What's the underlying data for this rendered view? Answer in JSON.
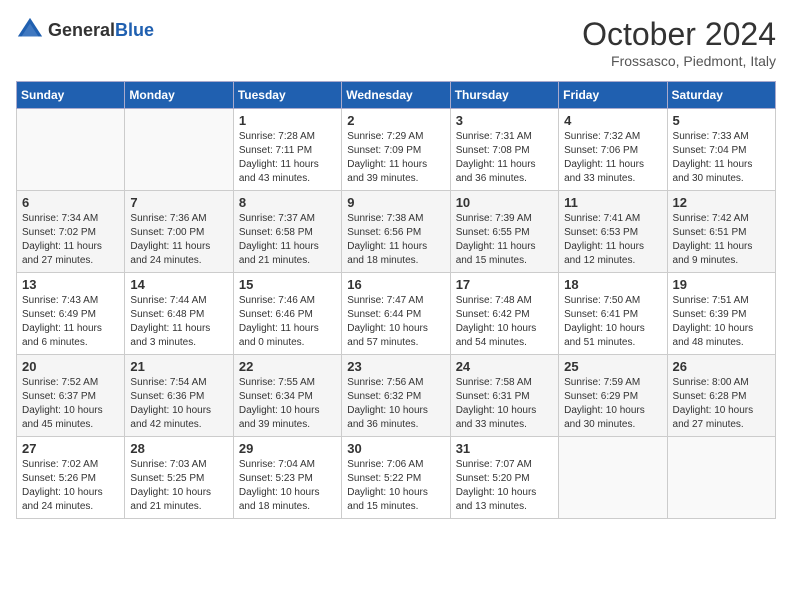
{
  "header": {
    "logo_general": "General",
    "logo_blue": "Blue",
    "month": "October 2024",
    "location": "Frossasco, Piedmont, Italy"
  },
  "weekdays": [
    "Sunday",
    "Monday",
    "Tuesday",
    "Wednesday",
    "Thursday",
    "Friday",
    "Saturday"
  ],
  "weeks": [
    [
      {
        "day": "",
        "info": ""
      },
      {
        "day": "",
        "info": ""
      },
      {
        "day": "1",
        "info": "Sunrise: 7:28 AM\nSunset: 7:11 PM\nDaylight: 11 hours and 43 minutes."
      },
      {
        "day": "2",
        "info": "Sunrise: 7:29 AM\nSunset: 7:09 PM\nDaylight: 11 hours and 39 minutes."
      },
      {
        "day": "3",
        "info": "Sunrise: 7:31 AM\nSunset: 7:08 PM\nDaylight: 11 hours and 36 minutes."
      },
      {
        "day": "4",
        "info": "Sunrise: 7:32 AM\nSunset: 7:06 PM\nDaylight: 11 hours and 33 minutes."
      },
      {
        "day": "5",
        "info": "Sunrise: 7:33 AM\nSunset: 7:04 PM\nDaylight: 11 hours and 30 minutes."
      }
    ],
    [
      {
        "day": "6",
        "info": "Sunrise: 7:34 AM\nSunset: 7:02 PM\nDaylight: 11 hours and 27 minutes."
      },
      {
        "day": "7",
        "info": "Sunrise: 7:36 AM\nSunset: 7:00 PM\nDaylight: 11 hours and 24 minutes."
      },
      {
        "day": "8",
        "info": "Sunrise: 7:37 AM\nSunset: 6:58 PM\nDaylight: 11 hours and 21 minutes."
      },
      {
        "day": "9",
        "info": "Sunrise: 7:38 AM\nSunset: 6:56 PM\nDaylight: 11 hours and 18 minutes."
      },
      {
        "day": "10",
        "info": "Sunrise: 7:39 AM\nSunset: 6:55 PM\nDaylight: 11 hours and 15 minutes."
      },
      {
        "day": "11",
        "info": "Sunrise: 7:41 AM\nSunset: 6:53 PM\nDaylight: 11 hours and 12 minutes."
      },
      {
        "day": "12",
        "info": "Sunrise: 7:42 AM\nSunset: 6:51 PM\nDaylight: 11 hours and 9 minutes."
      }
    ],
    [
      {
        "day": "13",
        "info": "Sunrise: 7:43 AM\nSunset: 6:49 PM\nDaylight: 11 hours and 6 minutes."
      },
      {
        "day": "14",
        "info": "Sunrise: 7:44 AM\nSunset: 6:48 PM\nDaylight: 11 hours and 3 minutes."
      },
      {
        "day": "15",
        "info": "Sunrise: 7:46 AM\nSunset: 6:46 PM\nDaylight: 11 hours and 0 minutes."
      },
      {
        "day": "16",
        "info": "Sunrise: 7:47 AM\nSunset: 6:44 PM\nDaylight: 10 hours and 57 minutes."
      },
      {
        "day": "17",
        "info": "Sunrise: 7:48 AM\nSunset: 6:42 PM\nDaylight: 10 hours and 54 minutes."
      },
      {
        "day": "18",
        "info": "Sunrise: 7:50 AM\nSunset: 6:41 PM\nDaylight: 10 hours and 51 minutes."
      },
      {
        "day": "19",
        "info": "Sunrise: 7:51 AM\nSunset: 6:39 PM\nDaylight: 10 hours and 48 minutes."
      }
    ],
    [
      {
        "day": "20",
        "info": "Sunrise: 7:52 AM\nSunset: 6:37 PM\nDaylight: 10 hours and 45 minutes."
      },
      {
        "day": "21",
        "info": "Sunrise: 7:54 AM\nSunset: 6:36 PM\nDaylight: 10 hours and 42 minutes."
      },
      {
        "day": "22",
        "info": "Sunrise: 7:55 AM\nSunset: 6:34 PM\nDaylight: 10 hours and 39 minutes."
      },
      {
        "day": "23",
        "info": "Sunrise: 7:56 AM\nSunset: 6:32 PM\nDaylight: 10 hours and 36 minutes."
      },
      {
        "day": "24",
        "info": "Sunrise: 7:58 AM\nSunset: 6:31 PM\nDaylight: 10 hours and 33 minutes."
      },
      {
        "day": "25",
        "info": "Sunrise: 7:59 AM\nSunset: 6:29 PM\nDaylight: 10 hours and 30 minutes."
      },
      {
        "day": "26",
        "info": "Sunrise: 8:00 AM\nSunset: 6:28 PM\nDaylight: 10 hours and 27 minutes."
      }
    ],
    [
      {
        "day": "27",
        "info": "Sunrise: 7:02 AM\nSunset: 5:26 PM\nDaylight: 10 hours and 24 minutes."
      },
      {
        "day": "28",
        "info": "Sunrise: 7:03 AM\nSunset: 5:25 PM\nDaylight: 10 hours and 21 minutes."
      },
      {
        "day": "29",
        "info": "Sunrise: 7:04 AM\nSunset: 5:23 PM\nDaylight: 10 hours and 18 minutes."
      },
      {
        "day": "30",
        "info": "Sunrise: 7:06 AM\nSunset: 5:22 PM\nDaylight: 10 hours and 15 minutes."
      },
      {
        "day": "31",
        "info": "Sunrise: 7:07 AM\nSunset: 5:20 PM\nDaylight: 10 hours and 13 minutes."
      },
      {
        "day": "",
        "info": ""
      },
      {
        "day": "",
        "info": ""
      }
    ]
  ]
}
